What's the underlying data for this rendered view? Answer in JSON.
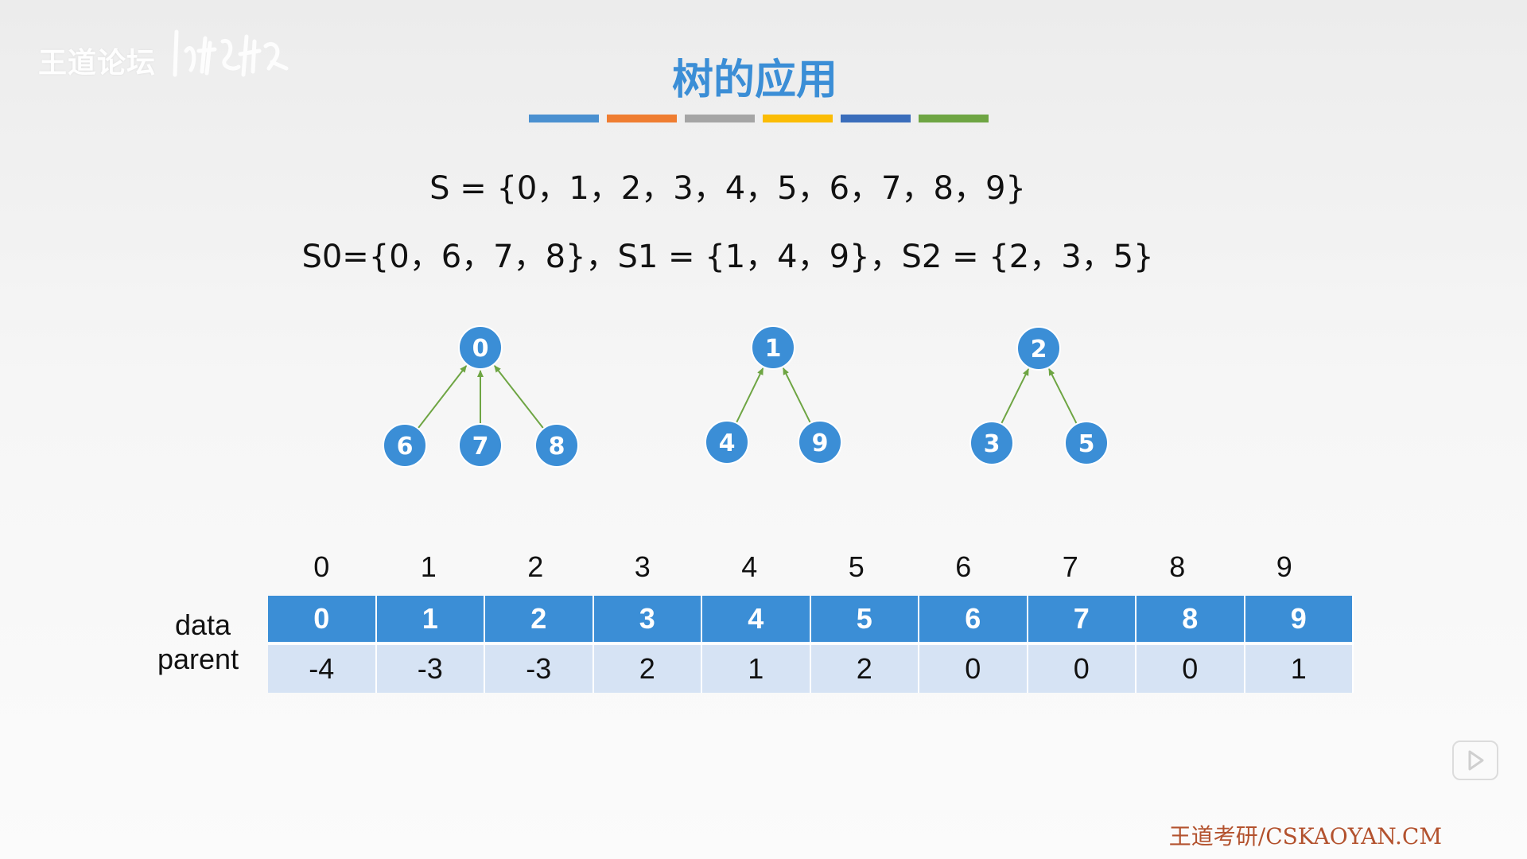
{
  "watermark": {
    "text": "王道论坛"
  },
  "slide": {
    "title": "树的应用",
    "title_color": "#3b8ed6",
    "color_bar": [
      "#4a90d0",
      "#ef7d31",
      "#a5a5a5",
      "#fbbc05",
      "#3a6dbb",
      "#6ea543"
    ],
    "formula_s": "S = {0，1，2，3，4，5，6，7，8，9}",
    "formula_subsets": "S0={0，6，7，8}，S1 = {1，4，9}，S2 = {2，3，5}",
    "trees": [
      {
        "root": "0",
        "children": [
          "6",
          "7",
          "8"
        ]
      },
      {
        "root": "1",
        "children": [
          "4",
          "9"
        ]
      },
      {
        "root": "2",
        "children": [
          "3",
          "5"
        ]
      }
    ],
    "node_color": "#3b8ed6",
    "edge_color": "#6ea543",
    "array": {
      "indices": [
        "0",
        "1",
        "2",
        "3",
        "4",
        "5",
        "6",
        "7",
        "8",
        "9"
      ],
      "row_label_data": "data",
      "row_label_parent": "parent",
      "data": [
        "0",
        "1",
        "2",
        "3",
        "4",
        "5",
        "6",
        "7",
        "8",
        "9"
      ],
      "parent": [
        "-4",
        "-3",
        "-3",
        "2",
        "1",
        "2",
        "0",
        "0",
        "0",
        "1"
      ]
    }
  },
  "footer": {
    "text": "王道考研/CSKAOYAN.CM"
  },
  "player": {
    "icon": "tv-play-icon"
  }
}
